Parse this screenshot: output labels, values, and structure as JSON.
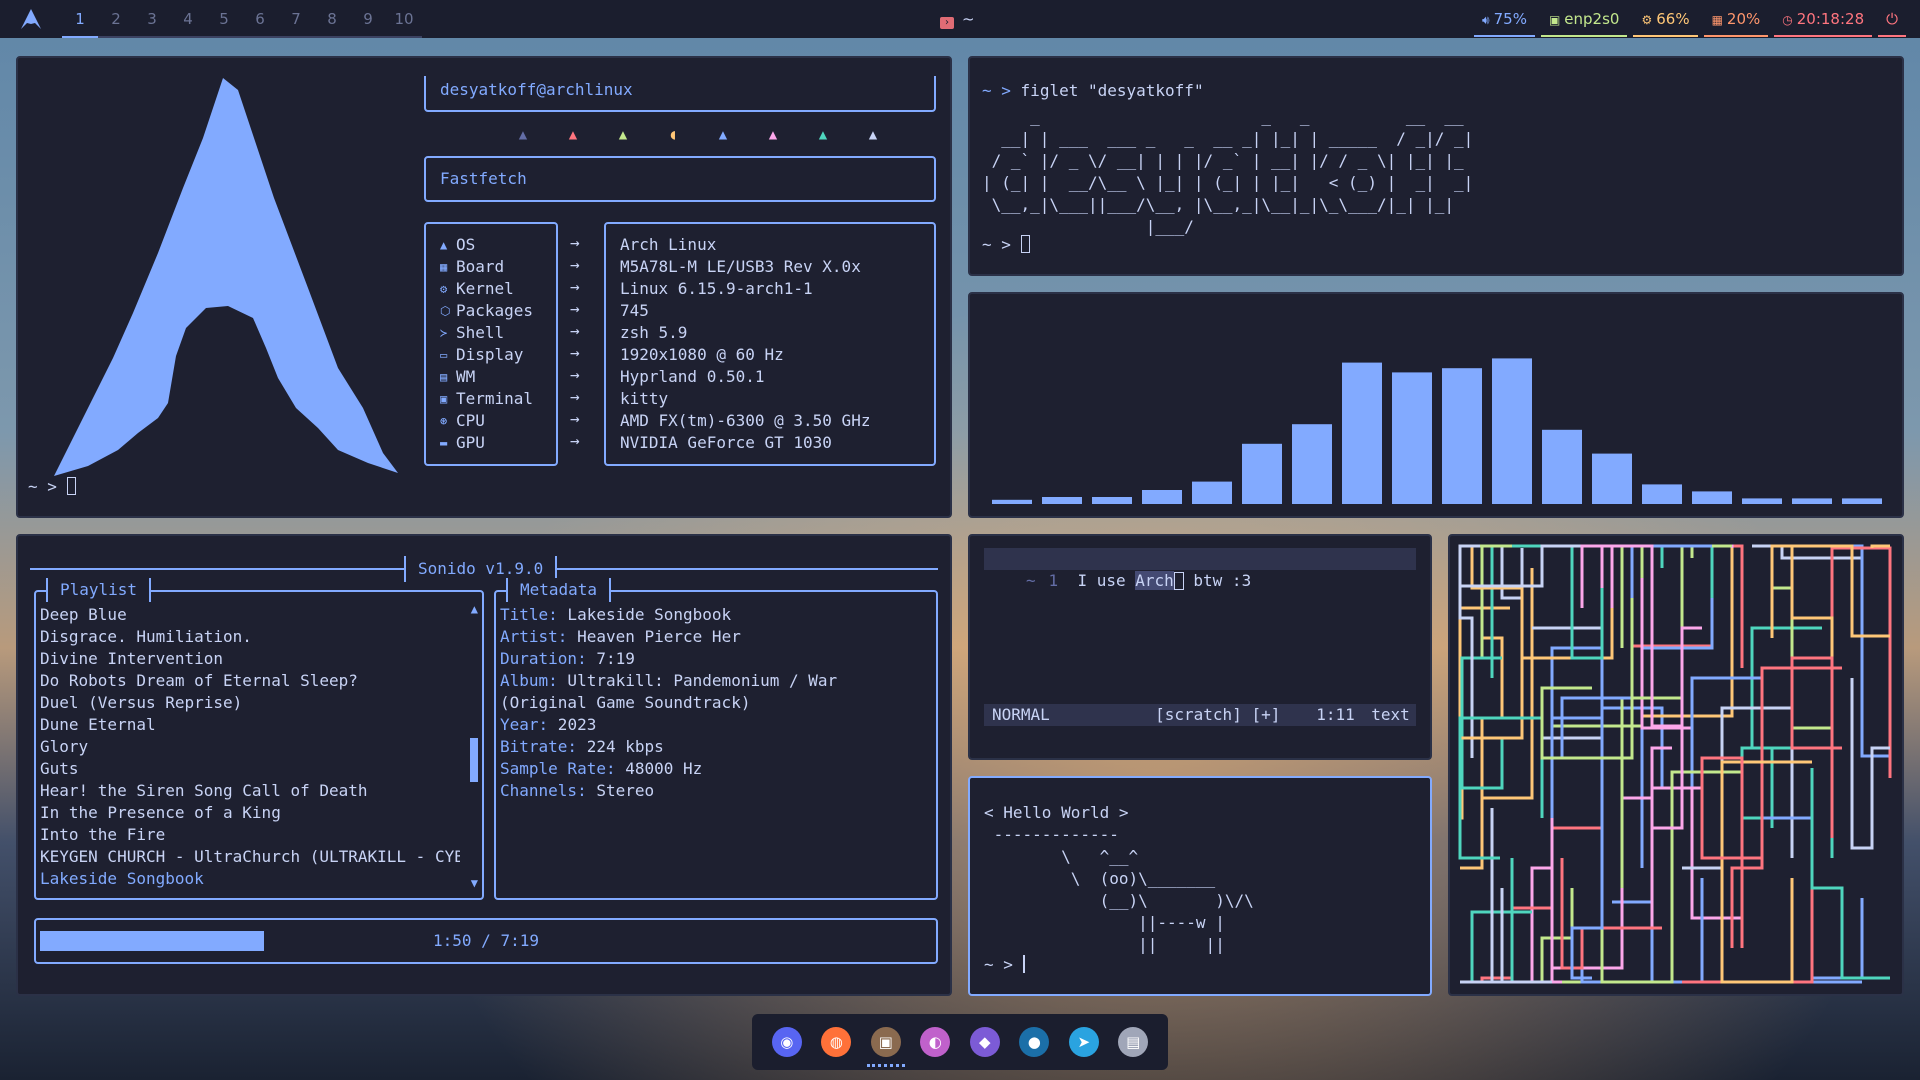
{
  "topbar": {
    "workspaces": [
      "1",
      "2",
      "3",
      "4",
      "5",
      "6",
      "7",
      "8",
      "9",
      "10"
    ],
    "active_workspace": "1",
    "window_title": "~",
    "volume": "75%",
    "network": "enp2s0",
    "cpu": "66%",
    "memory": "20%",
    "clock": "20:18:28",
    "colors": {
      "volume": "#82aaff",
      "network": "#c3e88d",
      "cpu": "#ffc777",
      "memory": "#ff966c",
      "clock": "#ff757f",
      "power": "#ff757f"
    }
  },
  "fastfetch": {
    "user_host": "desyatkoff@archlinux",
    "header": "Fastfetch",
    "labels": [
      "OS",
      "Board",
      "Kernel",
      "Packages",
      "Shell",
      "Display",
      "WM",
      "Terminal",
      "CPU",
      "GPU"
    ],
    "icons": [
      "arch-icon",
      "board-icon",
      "gear-icon",
      "package-icon",
      "shell-icon",
      "display-icon",
      "window-icon",
      "terminal-icon",
      "cpu-icon",
      "gpu-icon"
    ],
    "values": [
      "Arch Linux",
      "M5A78L-M LE/USB3 Rev X.0x",
      "Linux 6.15.9-arch1-1",
      "745",
      "zsh 5.9",
      "1920x1080 @ 60 Hz",
      "Hyprland 0.50.1",
      "kitty",
      "AMD FX(tm)-6300 @ 3.50 GHz",
      "NVIDIA GeForce GT 1030"
    ],
    "prompt": "~ >",
    "ghost_colors": [
      "#636da6",
      "#ff757f",
      "#c3e88d",
      "#ffc777",
      "#82aaff",
      "#fca7ea",
      "#4fd6be",
      "#c8d3f5"
    ]
  },
  "figlet": {
    "command": "figlet \"desyatkoff\"",
    "prompt": "~ >",
    "art": "     _                       _   _          __  __ \n  __| | ___  ___ _   _  __ _| |_| | _____  / _|/ _|\n / _` |/ _ \\/ __| | | |/ _` | __| |/ / _ \\| |_| |_ \n| (_| |  __/\\__ \\ |_| | (_| | |_|   < (_) |  _|  _|\n \\__,_|\\___||___/\\__, |\\__,_|\\__|_|\\_\\___/|_| |_|  \n                 |___/                             "
  },
  "visualizer": {
    "levels": [
      0.03,
      0.05,
      0.05,
      0.1,
      0.16,
      0.43,
      0.57,
      1.01,
      0.94,
      0.97,
      1.04,
      0.53,
      0.36,
      0.14,
      0.09,
      0.04,
      0.04,
      0.04
    ],
    "color": "#82aaff"
  },
  "player": {
    "title": "Sonido v1.9.0",
    "playlist_title": "Playlist",
    "metadata_title": "Metadata",
    "playlist": [
      "Deep Blue",
      "Disgrace. Humiliation.",
      "Divine Intervention",
      "Do Robots Dream of Eternal Sleep?",
      "Duel (Versus Reprise)",
      "Dune Eternal",
      "Glory",
      "Guts",
      "Hear! the Siren Song Call of Death",
      "In the Presence of a King",
      "Into the Fire",
      "KEYGEN CHURCH - UltraChurch (ULTRAKILL - CYB",
      "Lakeside Songbook"
    ],
    "current_track": "Lakeside Songbook",
    "meta_keys": [
      "Title:",
      "Artist:",
      "Duration:",
      "Album:",
      "",
      "Year:",
      "Bitrate:",
      "Sample Rate:",
      "Channels:"
    ],
    "meta_values": [
      "Lakeside Songbook",
      "Heaven Pierce Her",
      "7:19",
      "Ultrakill: Pandemonium / War",
      "(Original Game Soundtrack)",
      "2023",
      "224 kbps",
      "48000 Hz",
      "Stereo"
    ],
    "progress_text": "1:50 / 7:19",
    "progress": 0.25
  },
  "editor": {
    "line_number": "1",
    "line_text_before": "I use ",
    "line_text_selected": "Arch",
    "line_text_after": " btw :3",
    "tilde": "~",
    "mode": "NORMAL",
    "buffer": "[scratch] [+]",
    "position": "1:11",
    "filetype": "text"
  },
  "cowsay": {
    "art": "< Hello World >\n -------------\n        \\   ^__^\n         \\  (oo)\\_______\n            (__)\\       )\\/\\\n                ||----w |\n                ||     ||",
    "prompt": "~ >"
  },
  "dock": {
    "apps": [
      {
        "name": "discord-icon",
        "glyph": "◉",
        "color": "#5865f2"
      },
      {
        "name": "firefox-icon",
        "glyph": "◍",
        "color": "#ff7139"
      },
      {
        "name": "kitty-icon",
        "glyph": "▣",
        "color": "#8a6a4f"
      },
      {
        "name": "color-picker-icon",
        "glyph": "◐",
        "color": "#c061cb"
      },
      {
        "name": "obsidian-icon",
        "glyph": "◆",
        "color": "#7c5bd6"
      },
      {
        "name": "steam-icon",
        "glyph": "●",
        "color": "#1b6fa8"
      },
      {
        "name": "telegram-icon",
        "glyph": "➤",
        "color": "#2aa3e0"
      },
      {
        "name": "terminal-app-icon",
        "glyph": "▤",
        "color": "#a0a6b8"
      }
    ]
  }
}
